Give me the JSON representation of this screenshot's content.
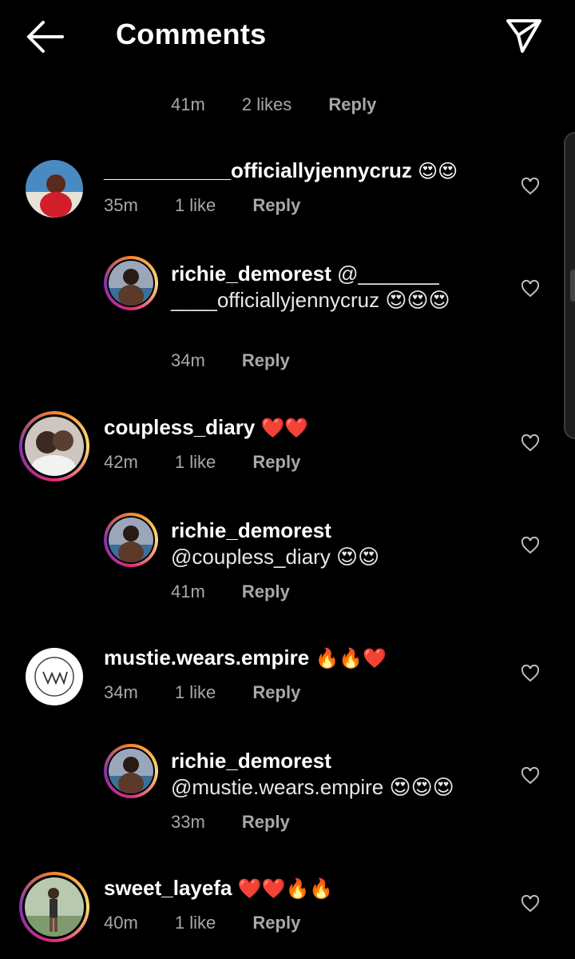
{
  "header": {
    "title": "Comments"
  },
  "partial": {
    "time": "41m",
    "likes": "2 likes",
    "reply": "Reply"
  },
  "comments": [
    {
      "user": "___________officiallyjennycruz",
      "text": "😍😍",
      "time": "35m",
      "likes": "1 like",
      "reply": "Reply",
      "avatar_colors": [
        "#d01f2a",
        "#3a6ea5"
      ]
    },
    {
      "user": "richie_demorest",
      "text": "@___________officiallyjennycruz 😍😍😍",
      "time": "34m",
      "reply": "Reply",
      "avatar_colors": [
        "#b0b6c4",
        "#2e6d99"
      ]
    },
    {
      "user": "coupless_diary",
      "text": "❤️❤️",
      "time": "42m",
      "likes": "1 like",
      "reply": "Reply",
      "avatar_colors": [
        "#3b2a24",
        "#cfc6bf"
      ]
    },
    {
      "user": "richie_demorest",
      "text": "@coupless_diary 😍😍",
      "time": "41m",
      "reply": "Reply",
      "avatar_colors": [
        "#b0b6c4",
        "#2e6d99"
      ]
    },
    {
      "user": "mustie.wears.empire",
      "text": "🔥🔥❤️",
      "time": "34m",
      "likes": "1 like",
      "reply": "Reply",
      "avatar_colors": [
        "#ffffff",
        "#333333"
      ]
    },
    {
      "user": "richie_demorest",
      "text": "@mustie.wears.empire 😍😍😍",
      "time": "33m",
      "reply": "Reply",
      "avatar_colors": [
        "#b0b6c4",
        "#2e6d99"
      ]
    },
    {
      "user": "sweet_layefa",
      "text": "❤️❤️🔥🔥",
      "time": "40m",
      "likes": "1 like",
      "reply": "Reply",
      "avatar_colors": [
        "#9bb59a",
        "#2f2f2f"
      ]
    }
  ],
  "icons": {
    "back": "arrow-left-icon",
    "send": "paper-plane-icon",
    "like": "heart-outline-icon"
  },
  "colors": {
    "background": "#000000",
    "text": "#ffffff",
    "meta": "#a8a8a8",
    "story_ring": "#dd2a7b"
  }
}
